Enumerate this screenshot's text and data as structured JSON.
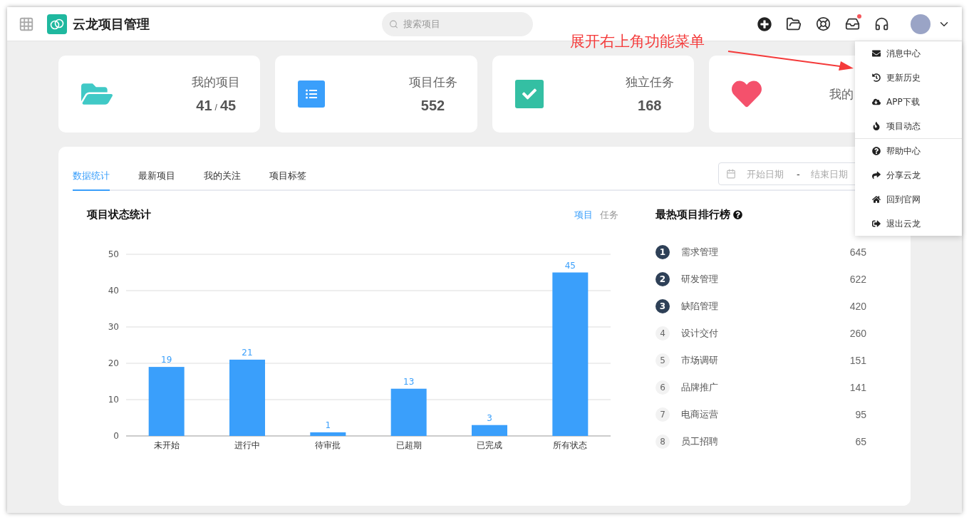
{
  "header": {
    "app_name": "云龙项目管理",
    "search": {
      "placeholder": "搜索项目"
    },
    "inbox_unread": true
  },
  "stat_cards": [
    {
      "label": "我的项目",
      "value": "41",
      "separator": "/",
      "total": "45"
    },
    {
      "label": "项目任务",
      "value": "552"
    },
    {
      "label": "独立任务",
      "value": "168"
    },
    {
      "label": "我的"
    }
  ],
  "tabs": [
    {
      "label": "数据统计",
      "selected": true
    },
    {
      "label": "最新项目",
      "selected": false
    },
    {
      "label": "我的关注",
      "selected": false
    },
    {
      "label": "项目标签",
      "selected": false
    }
  ],
  "date_range": {
    "start_placeholder": "开始日期",
    "separator": "-",
    "end_placeholder": "结束日期"
  },
  "status_chart": {
    "title": "项目状态统计",
    "toggles": [
      {
        "label": "项目",
        "selected": true
      },
      {
        "label": "任务",
        "selected": false
      }
    ],
    "chart_data": {
      "type": "bar",
      "categories": [
        "未开始",
        "进行中",
        "待审批",
        "已超期",
        "已完成",
        "所有状态"
      ],
      "series": [
        {
          "color": "#3a9ffb",
          "values": [
            19,
            21,
            1,
            13,
            3,
            45
          ]
        }
      ],
      "ylim": [
        0,
        50
      ],
      "yticks": [
        0,
        10,
        20,
        30,
        40,
        50
      ],
      "data_labels": true,
      "grid": true
    }
  },
  "ranking": {
    "title": "最热项目排行榜",
    "items": [
      {
        "rank": "1",
        "name": "需求管理",
        "count": "645",
        "highlighted": true
      },
      {
        "rank": "2",
        "name": "研发管理",
        "count": "622",
        "highlighted": true
      },
      {
        "rank": "3",
        "name": "缺陷管理",
        "count": "420",
        "highlighted": true
      },
      {
        "rank": "4",
        "name": "设计交付",
        "count": "260",
        "highlighted": false
      },
      {
        "rank": "5",
        "name": "市场调研",
        "count": "151",
        "highlighted": false
      },
      {
        "rank": "6",
        "name": "品牌推广",
        "count": "141",
        "highlighted": false
      },
      {
        "rank": "7",
        "name": "电商运营",
        "count": "95",
        "highlighted": false
      },
      {
        "rank": "8",
        "name": "员工招聘",
        "count": "65",
        "highlighted": false
      }
    ]
  },
  "user_menu": {
    "groups": [
      [
        "消息中心",
        "更新历史",
        "APP下载",
        "项目动态"
      ],
      [
        "帮助中心",
        "分享云龙",
        "回到官网",
        "退出云龙"
      ]
    ]
  },
  "annotation": "展开右上角功能菜单"
}
